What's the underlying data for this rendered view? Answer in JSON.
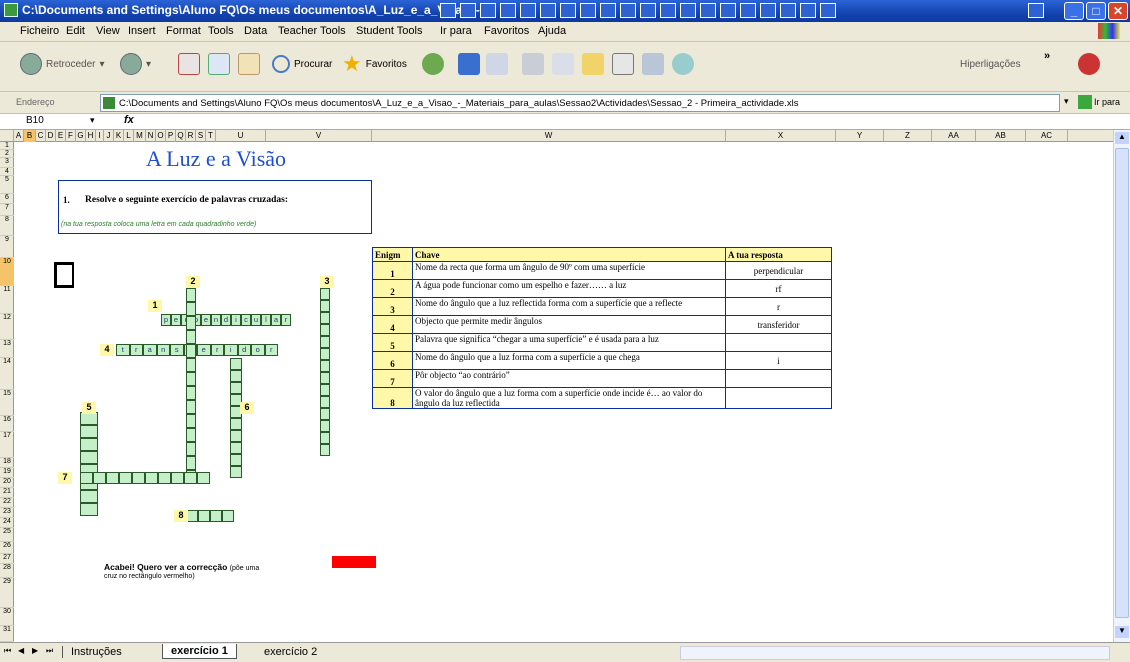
{
  "window": {
    "title": "C:\\Documents and Settings\\Aluno FQ\\Os meus documentos\\A_Luz_e_a_Visao_-"
  },
  "menu": [
    "Ficheiro",
    "Edit",
    "View",
    "Insert",
    "Format",
    "Tools",
    "Data",
    "Teacher Tools",
    "Student Tools",
    "Ir para",
    "Favoritos",
    "Ajuda"
  ],
  "toolbar": {
    "back": "Retroceder",
    "search": "Procurar",
    "favorites": "Favoritos",
    "links": "Hiperligações"
  },
  "address": {
    "label": "Endereço",
    "value": "C:\\Documents and Settings\\Aluno FQ\\Os meus documentos\\A_Luz_e_a_Visao_-_Materiais_para_aulas\\Sessao2\\Actividades\\Sessao_2 - Primeira_actividade.xls",
    "go": "Ir para"
  },
  "namebox": "B10",
  "fx": "fx",
  "columns": [
    "A",
    "B",
    "C",
    "D",
    "E",
    "F",
    "G",
    "H",
    "I",
    "J",
    "K",
    "L",
    "M",
    "N",
    "O",
    "P",
    "Q",
    "R",
    "S",
    "T",
    "U",
    "V",
    "W",
    "X",
    "Y",
    "Z",
    "AA",
    "AB",
    "AC"
  ],
  "rows": [
    "1",
    "2",
    "3",
    "4",
    "5",
    "6",
    "7",
    "8",
    "9",
    "10",
    "11",
    "12",
    "13",
    "14",
    "15",
    "16",
    "17",
    "18",
    "19",
    "20",
    "21",
    "22",
    "23",
    "24",
    "25",
    "26",
    "27",
    "28",
    "29",
    "30",
    "31"
  ],
  "sheet": {
    "heading": "A Luz e a Visão",
    "instruction_num": "1.",
    "instruction": "Resolve o seguinte exercício de palavras cruzadas:",
    "instruction_hint": "(na tua resposta coloca uma letra em cada quadradinho verde)",
    "finish": "Acabei! Quero ver a correcção",
    "finish_hint1": "(põe uma",
    "finish_hint2": "cruz no rectângulo vermelho)"
  },
  "crossword": {
    "word1": [
      "p",
      "e",
      "r",
      "p",
      "e",
      "n",
      "d",
      "i",
      "c",
      "u",
      "l",
      "a",
      "r"
    ],
    "word4": [
      "t",
      "r",
      "a",
      "n",
      "s",
      "f",
      "e",
      "r",
      "i",
      "d",
      "o",
      "r"
    ],
    "labels": [
      "1",
      "2",
      "3",
      "4",
      "5",
      "6",
      "7",
      "8"
    ]
  },
  "table": {
    "headers": [
      "Enigm",
      "Chave",
      "A tua resposta"
    ],
    "rows": [
      {
        "n": "1",
        "clue": "Nome da recta que forma um ângulo de 90º com uma superfície",
        "answer": "perpendicular"
      },
      {
        "n": "2",
        "clue": "A água pode funcionar como um espelho e fazer…… a luz",
        "answer": "rf"
      },
      {
        "n": "3",
        "clue": "Nome do ângulo que a luz reflectida forma com a superfície que a reflecte",
        "answer": "r"
      },
      {
        "n": "4",
        "clue": "Objecto que permite medir ângulos",
        "answer": "transferidor"
      },
      {
        "n": "5",
        "clue": "Palavra que significa “chegar a uma superfície” e é usada para a luz",
        "answer": ""
      },
      {
        "n": "6",
        "clue": "Nome do ângulo que a luz forma com a superfície a que chega",
        "answer": "i"
      },
      {
        "n": "7",
        "clue": "Pôr objecto  “ao contrário”",
        "answer": ""
      },
      {
        "n": "8",
        "clue": "O valor do ângulo que a luz forma com a superfície onde incide é… ao valor do ângulo da luz reflectida",
        "answer": ""
      }
    ]
  },
  "tabs": [
    "Instruções",
    "exercício 1",
    "exercício 2"
  ],
  "colors": {
    "title_blue": "#1f4fd0",
    "cell_green": "#c5efc8",
    "label_yellow": "#fff8a8",
    "table_border": "#0a2ea0",
    "red": "#ff0000"
  }
}
